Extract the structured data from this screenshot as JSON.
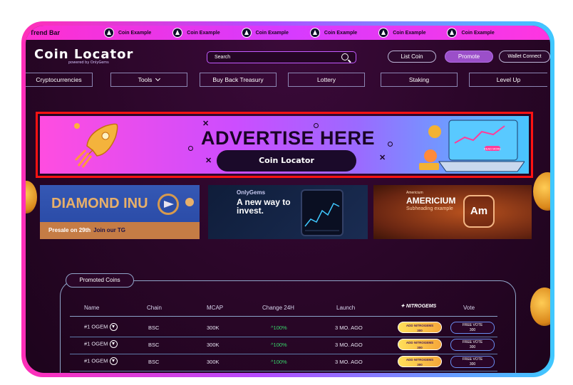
{
  "trend_bar": {
    "title": "Trend Bar",
    "items": [
      "Coin Example",
      "Coin Example",
      "Coin Example",
      "Coin Example",
      "Coin Example",
      "Coin Example"
    ]
  },
  "header": {
    "logo": "Coin Locator",
    "logo_sub": "powered by OnlyGems",
    "search_placeholder": "Search",
    "list_coin": "List Coin",
    "promote": "Promote",
    "wallet_connect": "Wallet Connect"
  },
  "nav": [
    {
      "label": "Cryptocurrencies"
    },
    {
      "label": "Tools"
    },
    {
      "label": "Buy Back Treasury"
    },
    {
      "label": "Lottery"
    },
    {
      "label": "Staking"
    },
    {
      "label": "Level Up"
    }
  ],
  "ad": {
    "title": "ADVERTISE HERE",
    "pill_logo": "Coin Locator",
    "laptop_button": "READ MORE"
  },
  "promos": {
    "card1": {
      "brand": "DIAMOND INU",
      "presale": "Presale on 29th",
      "join": "Join our TG"
    },
    "card2": {
      "brand": "OnlyGems",
      "headline": "A new way to invest."
    },
    "card3": {
      "kicker": "Americium",
      "title": "AMERICIUM",
      "subtitle": "Subheading example",
      "symbol": "Am"
    }
  },
  "promoted": {
    "tab_label": "Promoted Coins",
    "columns": [
      "Name",
      "Chain",
      "MCAP",
      "Change 24H",
      "Launch",
      "NITROGEMS",
      "Vote"
    ],
    "rows": [
      {
        "name": "#1 OGEM",
        "chain": "BSC",
        "mcap": "300K",
        "change": "^100%",
        "launch": "3 MO. AGO",
        "nitro": "ADD NITROGEMS",
        "nitro_count": "300",
        "vote": "FREE VOTE",
        "vote_count": "300"
      },
      {
        "name": "#1 OGEM",
        "chain": "BSC",
        "mcap": "300K",
        "change": "^100%",
        "launch": "3 MO. AGO",
        "nitro": "ADD NITROGEMS",
        "nitro_count": "300",
        "vote": "FREE VOTE",
        "vote_count": "300"
      },
      {
        "name": "#1 OGEM",
        "chain": "BSC",
        "mcap": "300K",
        "change": "^100%",
        "launch": "3 MO. AGO",
        "nitro": "ADD NITROGEMS",
        "nitro_count": "300",
        "vote": "FREE VOTE",
        "vote_count": "300"
      }
    ]
  },
  "colors": {
    "frame_gradient_start": "#ff2fb8",
    "frame_gradient_end": "#3fc8ff",
    "highlight_border": "#ff1212",
    "positive_change": "#37d66a",
    "background": "#2a0628"
  }
}
